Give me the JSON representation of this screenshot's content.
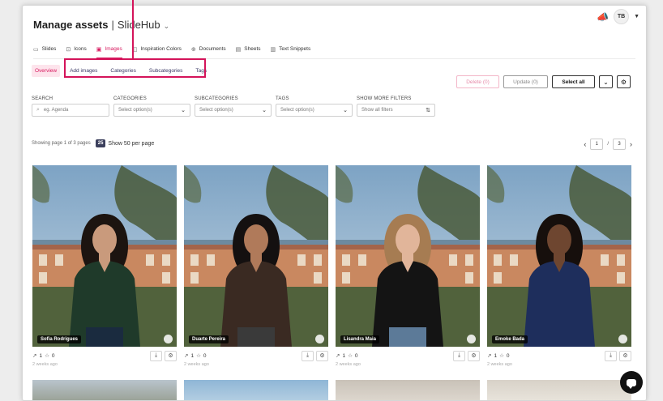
{
  "header": {
    "title": "Manage assets",
    "separator": "|",
    "brand": "SlideHub",
    "brand_chevron": "⌄",
    "user_initials": "TB"
  },
  "tabs": [
    {
      "label": "Slides",
      "icon": "slides-icon",
      "active": false
    },
    {
      "label": "Icons",
      "icon": "icons-icon",
      "active": false
    },
    {
      "label": "Images",
      "icon": "images-icon",
      "active": true
    },
    {
      "label": "Inspiration Colors",
      "icon": "palette-icon",
      "active": false
    },
    {
      "label": "Documents",
      "icon": "documents-icon",
      "active": false
    },
    {
      "label": "Sheets",
      "icon": "sheets-icon",
      "active": false
    },
    {
      "label": "Text Snippets",
      "icon": "text-snippets-icon",
      "active": false
    }
  ],
  "subtabs": [
    {
      "label": "Overview",
      "active": true
    },
    {
      "label": "Add images",
      "active": false
    },
    {
      "label": "Categories",
      "active": false
    },
    {
      "label": "Subcategories",
      "active": false
    },
    {
      "label": "Tags",
      "active": false
    }
  ],
  "actions": {
    "delete": "Delete (0)",
    "update": "Update (0)",
    "select_all": "Select all"
  },
  "filters": {
    "search_label": "SEARCH",
    "search_placeholder": "eg. Agenda",
    "categories_label": "CATEGORIES",
    "categories_value": "Select option(s)",
    "subcategories_label": "SUBCATEGORIES",
    "subcategories_value": "Select option(s)",
    "tags_label": "TAGS",
    "tags_value": "Select option(s)",
    "more_label": "SHOW MORE FILTERS",
    "more_value": "Show all filters"
  },
  "paging": {
    "showing": "Showing page 1 of 3 pages",
    "per_page_badge": "25",
    "per_page_link": "Show 50 per page",
    "current_page": "1",
    "separator": "/",
    "total_pages": "3"
  },
  "cards": [
    {
      "name": "Sofia Rodrigues",
      "uses": "1",
      "favorites": "0",
      "ago": "2 weeks ago",
      "skin": "#c99a7c",
      "hair": "#1c1410",
      "shirt": "#1f3a2a",
      "pants": "#1a2b3f"
    },
    {
      "name": "Duarte Pereira",
      "uses": "1",
      "favorites": "0",
      "ago": "2 weeks ago",
      "skin": "#b07a5a",
      "hair": "#141010",
      "shirt": "#3a2a22",
      "pants": "#3a3a3a"
    },
    {
      "name": "Lisandra Maia",
      "uses": "1",
      "favorites": "0",
      "ago": "2 weeks ago",
      "skin": "#e1b59a",
      "hair": "#a67c52",
      "shirt": "#141414",
      "pants": "#5c7a98"
    },
    {
      "name": "Emoke Bada",
      "uses": "1",
      "favorites": "0",
      "ago": "2 weeks ago",
      "skin": "#6e4630",
      "hair": "#160f0c",
      "shirt": "#1e2e5c",
      "pants": "#1e2e5c"
    }
  ]
}
